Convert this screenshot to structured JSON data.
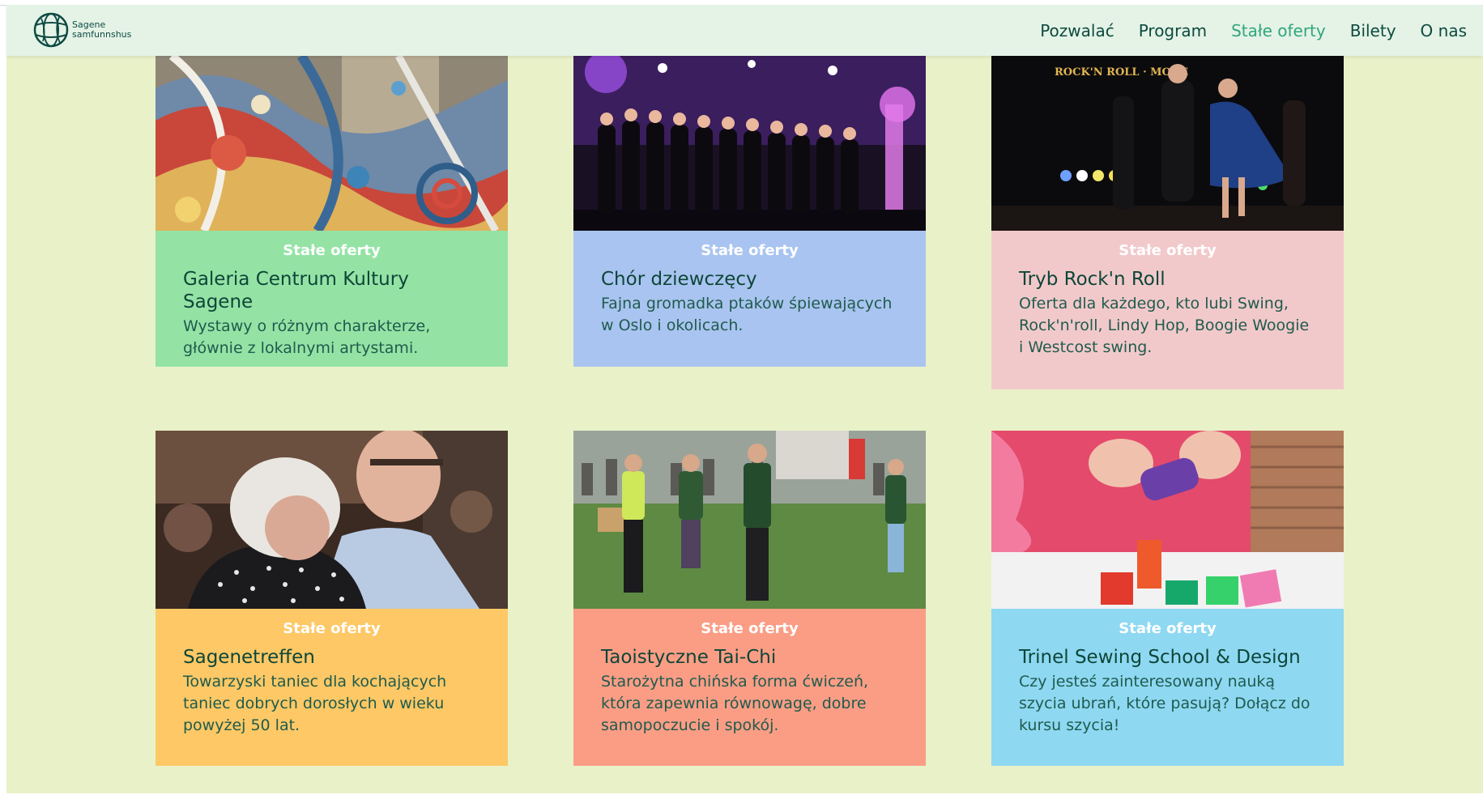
{
  "logo": {
    "line1": "Sagene",
    "line2": "samfunnshus"
  },
  "nav": {
    "items": [
      {
        "label": "Pozwalać",
        "active": false
      },
      {
        "label": "Program",
        "active": false
      },
      {
        "label": "Stałe oferty",
        "active": true
      },
      {
        "label": "Bilety",
        "active": false
      },
      {
        "label": "O nas",
        "active": false
      }
    ]
  },
  "colors": {
    "page_bg": "#e9f1c9",
    "header_bg": "#e4f3e6",
    "nav_text": "#0d4a3f",
    "nav_active": "#31a57c",
    "title_text": "#0e4638"
  },
  "cards": [
    {
      "tag": "Stałe oferty",
      "title": "Galeria Centrum Kultury Sagene",
      "description": "Wystawy o różnym charakterze, głównie z lokalnymi artystami.",
      "color": "#94e3a5",
      "image": "mosaic-art-image"
    },
    {
      "tag": "Stałe oferty",
      "title": "Chór dziewczęcy",
      "description": "Fajna gromadka ptaków śpiewających w Oslo i okolicach.",
      "color": "#a9c4f0",
      "image": "choir-stage-image"
    },
    {
      "tag": "Stałe oferty",
      "title": "Tryb Rock'n Roll",
      "description": "Oferta dla każdego, kto lubi Swing, Rock'n'roll, Lindy Hop, Boogie Woogie i Westcost swing.",
      "color": "#f2c9cb",
      "image": "dance-stage-image",
      "image_text": "ROCK'N ROLL · MODE"
    },
    {
      "tag": "Stałe oferty",
      "title": "Sagenetreffen",
      "description": "Towarzyski taniec dla kochających taniec dobrych dorosłych w wieku powyżej 50 lat.",
      "color": "#fdc865",
      "image": "senior-dance-image"
    },
    {
      "tag": "Stałe oferty",
      "title": "Taoistyczne Tai-Chi",
      "description": "Starożytna chińska forma ćwiczeń, która zapewnia równowagę, dobre samopoczucie i spokój.",
      "color": "#fb9d85",
      "image": "tai-chi-park-image"
    },
    {
      "tag": "Stałe oferty",
      "title": "Trinel Sewing School & Design",
      "description": "Czy jesteś zainteresowany nauką szycia ubrań, które pasują? Dołącz do kursu szycia!",
      "color": "#8ed8f2",
      "image": "sewing-threads-image"
    }
  ]
}
